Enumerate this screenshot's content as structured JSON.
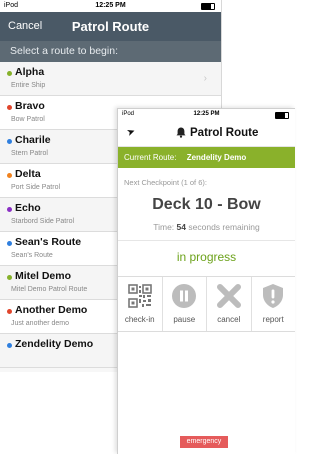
{
  "phone1": {
    "status": {
      "carrier": "iPod",
      "time": "12:25 PM"
    },
    "nav": {
      "cancel": "Cancel",
      "title": "Patrol Route"
    },
    "prompt": "Select a route to begin:",
    "routes": [
      {
        "name": "Alpha",
        "sub": "Entire Ship",
        "color": "#86b12a"
      },
      {
        "name": "Bravo",
        "sub": "Bow Patrol",
        "color": "#e0452c"
      },
      {
        "name": "Charile",
        "sub": "Stern Patrol",
        "color": "#2f7fde"
      },
      {
        "name": "Delta",
        "sub": "Port Side Patrol",
        "color": "#f0821e"
      },
      {
        "name": "Echo",
        "sub": "Starbord Side Patrol",
        "color": "#8a2fc4"
      },
      {
        "name": "Sean's Route",
        "sub": "Sean's Route",
        "color": "#2f7fde"
      },
      {
        "name": "Mitel Demo",
        "sub": "Mitel Demo Patrol Route",
        "color": "#86b12a"
      },
      {
        "name": "Another Demo",
        "sub": "Just another demo",
        "color": "#e0452c"
      },
      {
        "name": "Zendelity Demo",
        "sub": "",
        "color": "#2f7fde"
      }
    ]
  },
  "phone2": {
    "status": {
      "carrier": "iPod",
      "time": "12:25 PM"
    },
    "nav": {
      "title": "Patrol Route"
    },
    "route_bar": {
      "label": "Current Route:",
      "value": "Zendelity Demo"
    },
    "checkpoint_label": "Next Checkpoint (1 of 6):",
    "checkpoint_name": "Deck 10 - Bow",
    "time": {
      "prefix": "Time:",
      "value": "54",
      "suffix": "seconds remaining"
    },
    "progress": "in progress",
    "actions": [
      {
        "label": "check-in",
        "icon": "qr-code-icon"
      },
      {
        "label": "pause",
        "icon": "pause-icon"
      },
      {
        "label": "cancel",
        "icon": "x-icon"
      },
      {
        "label": "report",
        "icon": "shield-alert-icon"
      }
    ],
    "emergency": "emergency"
  },
  "colors": {
    "nav_dark": "#4a5966",
    "accent_green": "#8ab12b",
    "progress_green": "#6ca21b",
    "emergency_red": "#e55b5b"
  }
}
